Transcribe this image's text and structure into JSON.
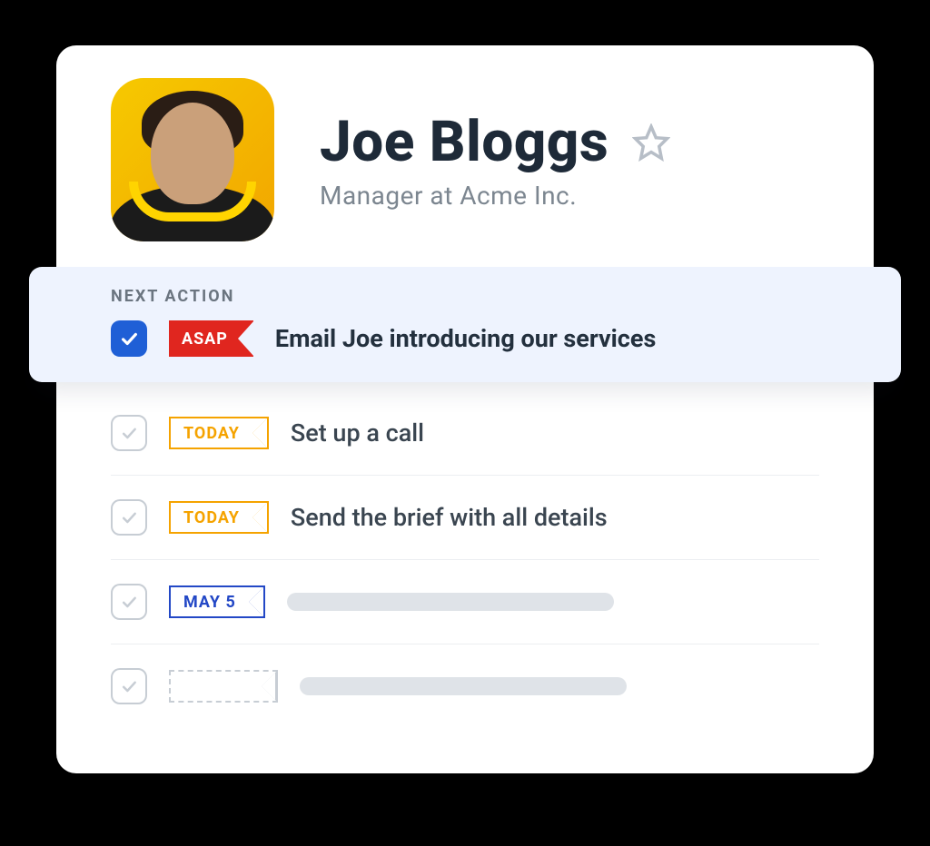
{
  "contact": {
    "name": "Joe Bloggs",
    "title": "Manager at Acme Inc."
  },
  "next_action": {
    "label": "NEXT ACTION",
    "flag": "ASAP",
    "text": "Email Joe introducing our services"
  },
  "tasks": [
    {
      "flag_type": "today",
      "flag_text": "TODAY",
      "text": "Set up a call"
    },
    {
      "flag_type": "today",
      "flag_text": "TODAY",
      "text": "Send the brief with all details"
    },
    {
      "flag_type": "date",
      "flag_text": "MAY 5",
      "text": ""
    },
    {
      "flag_type": "blank",
      "flag_text": "",
      "text": ""
    }
  ]
}
